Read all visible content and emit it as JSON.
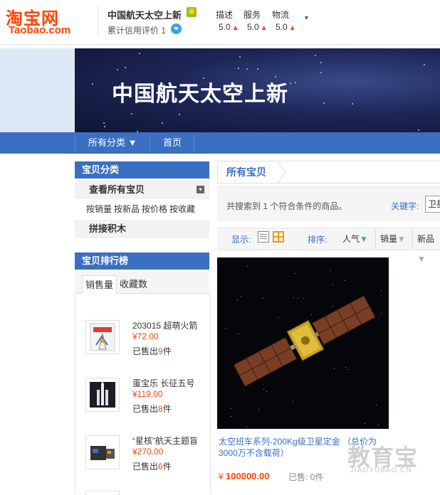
{
  "header": {
    "logo_cn": "淘宝网",
    "logo_en": "Taobao.com",
    "shop_name": "中国航天太空上新",
    "credit_label": "累计信用评价 1",
    "dsr": [
      {
        "label": "描述",
        "value": "5.0"
      },
      {
        "label": "服务",
        "value": "5.0"
      },
      {
        "label": "物流",
        "value": "5.0"
      }
    ],
    "up_glyph": "🠝",
    "dropdown_glyph": "▼"
  },
  "banner": {
    "title": "中国航天太空上新"
  },
  "nav": {
    "all_categories": "所有分类 ▼",
    "home": "首页"
  },
  "categories": {
    "header": "宝贝分类",
    "view_all": "查看所有宝贝",
    "sort_links": [
      "按销量",
      "按新品",
      "按价格",
      "按收藏"
    ],
    "group": "拼接积木"
  },
  "ranking": {
    "header": "宝贝排行榜",
    "tabs": [
      "销售量",
      "收藏数"
    ],
    "items": [
      {
        "title": "203015 超萌火箭",
        "price": "¥72.00",
        "sold_prefix": "已售出",
        "sold_count": "9",
        "sold_suffix": "件"
      },
      {
        "title": "蛋宝乐 长征五号",
        "price": "¥119.00",
        "sold_prefix": "已售出",
        "sold_count": "8",
        "sold_suffix": "件"
      },
      {
        "title": "“星核”航天主题盲",
        "price": "¥270.00",
        "sold_prefix": "已售出",
        "sold_count": "6",
        "sold_suffix": "件"
      }
    ]
  },
  "main": {
    "title": "所有宝贝",
    "search_result": "共搜索到 1 个符合条件的商品。",
    "keyword_label": "关键字:",
    "keyword_value": "卫星",
    "display_label": "显示:",
    "sort_label": "排序:",
    "sort_options": [
      "人气",
      "销量",
      "新品"
    ],
    "product": {
      "title": "太空班车系列-200Kg级卫星定金 （总价为3000万不含载荷）",
      "price_symbol": "¥",
      "price": "100000.00",
      "sold": "已售: 0件"
    }
  },
  "watermark": {
    "cn": "教育宝",
    "en": "JIAOYUBAO.CN"
  },
  "colors": {
    "brand": "#ff4400",
    "nav": "#3a6fc2",
    "link": "#3a6fc2"
  }
}
